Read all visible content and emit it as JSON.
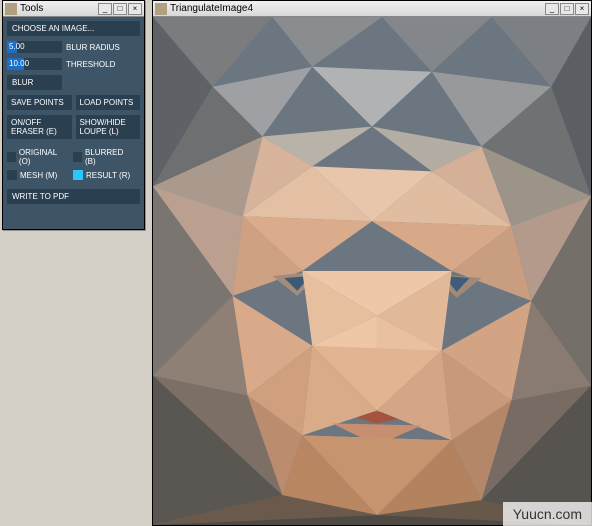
{
  "tools": {
    "title": "Tools",
    "choose": "CHOOSE AN IMAGE...",
    "blur_radius": {
      "value": "5.00",
      "label": "BLUR RADIUS",
      "fill": 18
    },
    "threshold": {
      "value": "10.00",
      "label": "THRESHOLD",
      "fill": 30
    },
    "blur_btn": "BLUR",
    "save_points": "SAVE POINTS",
    "load_points": "LOAD POINTS",
    "eraser": "ON/OFF ERASER (E)",
    "loupe": "SHOW/HIDE LOUPE (L)",
    "checks": {
      "original": "ORIGINAL (O)",
      "blurred": "BLURRED (B)",
      "mesh": "MESH (M)",
      "result": "RESULT (R)"
    },
    "write_pdf": "WRITE TO PDF"
  },
  "imgwin": {
    "title": "TriangulateImage4"
  },
  "sys": {
    "min": "_",
    "max": "□",
    "close": "×"
  },
  "watermark": "Yuucn.com"
}
